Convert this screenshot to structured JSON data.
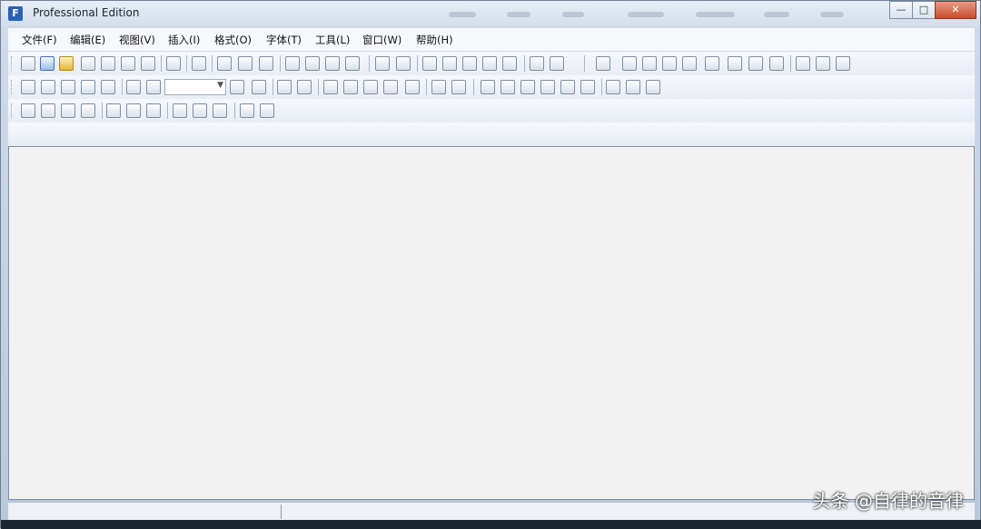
{
  "window": {
    "title": "Professional Edition",
    "controls": [
      "minimize",
      "maximize",
      "close"
    ]
  },
  "menu": {
    "items": [
      "文件(F)",
      "编辑(E)",
      "视图(V)",
      "插入(I)",
      "格式(O)",
      "字体(T)",
      "工具(L)",
      "窗口(W)",
      "帮助(H)"
    ]
  },
  "toolbar": {
    "combo_value": ""
  },
  "statusbar": {
    "left": "",
    "right": ""
  },
  "watermark": "头条 @自律的音律",
  "colors": {
    "window_gradient_top": "#e7eef7",
    "window_gradient_bottom": "#d3deea",
    "workspace": "#f2f2f2"
  }
}
